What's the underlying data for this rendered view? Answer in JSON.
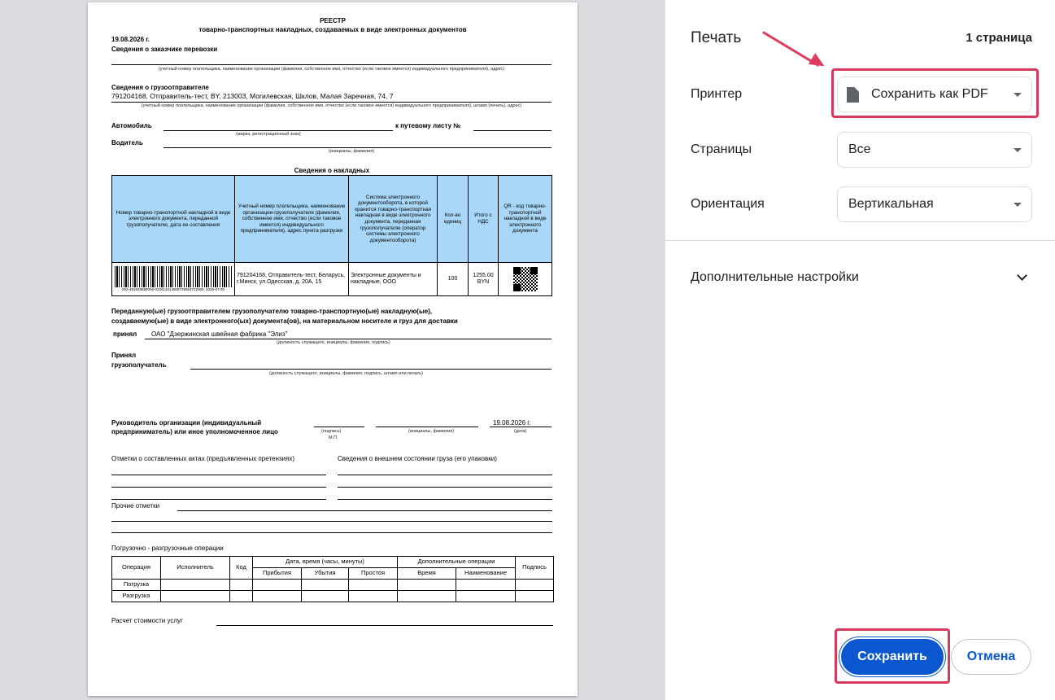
{
  "document": {
    "title": "РЕЕСТР",
    "subtitle": "товарно-транспортных накладных, создаваемых в виде электронных документов",
    "date": "19.08.2026 г.",
    "customer_heading": "Сведения о заказчике перевозки",
    "customer_note": "(учетный номер плательщика, наименование организации (фамилия, собственное имя, отчество (если таковое имеется) индивидуального предпринимателя), адрес)",
    "shipper_heading": "Сведения о грузоотправителе",
    "shipper_value": "791204168, Отправитель-тест, BY, 213003, Могилевская, Шклов, Малая Заречная, 74, 7",
    "shipper_note": "(учетный номер плательщика, наименование организации (фамилия, собственное имя, отчество (если таковое имеется) индивидуального предпринимателя), штамп (печать), адрес)",
    "car_label": "Автомобиль",
    "waybill_label": "к путевому листу №",
    "car_note": "(марка, регистрационный знак)",
    "driver_label": "Водитель",
    "driver_note": "(инициалы, фамилия)",
    "invoices_heading": "Сведения о накладных",
    "invoice_columns": [
      "Номер товарно-транспортной накладной в виде электронного документа, переданной грузополучателю, дата ее составления",
      "Учетный номер плательщика, наименование организации-грузополучателя (фамилия, собственное имя, отчество (если таковое имеется) индивидуального предпринимателя), адрес пункта разгрузки",
      "Система электронного документооборота, в которой хранится товарно-транспортная накладная в виде электронного документа, переданная грузополучателю (оператор системы электронного документооборота)",
      "Кол-во единиц",
      "Итого с НДС",
      "QR - код товарно-транспортной накладной в виде электронного документа"
    ],
    "invoice_row": {
      "barcode_text": "002-481929589006-022813414909739953722060, 2026-07-30",
      "consignee": "791204168, Отправитель-тест, Беларусь, г.Минск, ул.Одесская, д. 20А, 15",
      "system": "Электронные документы и накладные, ООО",
      "qty": "100",
      "total": "1255.00 BYN"
    },
    "transfer_text_1": "Переданную(ые) грузоотправителем грузополучателю товарно-транспортную(ые) накладную(ые),",
    "transfer_text_2": "создаваемую(ые) в виде электронного(ых) документа(ов), на материальном носителе и груз для доставки",
    "accepted_label": "принял",
    "accepted_value": "ОАО \"Дзержинская швейная фабрика \"Элиз\"",
    "accepted_note": "(должность служащего, инициалы, фамилия, подпись)",
    "consignee_label_1": "Принял",
    "consignee_label_2": "грузополучатель",
    "consignee_note": "(должность служащего, инициалы, фамилия, подпись, штамп или печать)",
    "head_label_1": "Руководитель организации (индивидуальный",
    "head_label_2": "предприниматель) или иное уполномоченное лицо",
    "sign_note": "(подпись)",
    "mp_note": "М.П.",
    "initials_note": "(инициалы, фамилия)",
    "head_date": "19.08.2026 г.",
    "date_note": "(дата)",
    "acts_label": "Отметки о составленных актах (предъявленных претензиях)",
    "condition_label": "Сведения о внешнем состоянии груза (его упаковки)",
    "other_label": "Прочие отметки",
    "loading_label": "Погрузочно - разгрузочные операции",
    "ops_headers": {
      "operation": "Операция",
      "executor": "Исполнитель",
      "code": "Код",
      "datetime": "Дата, время (часы, минуты)",
      "arrival": "Прибытия",
      "departure": "Убытия",
      "idle": "Простоя",
      "extra": "Дополнительные операции",
      "time": "Время",
      "name": "Наименование",
      "signature": "Подпись"
    },
    "ops_rows": [
      "Погрузка",
      "Разгрузка"
    ],
    "cost_label": "Расчет стоимости услуг"
  },
  "panel": {
    "title": "Печать",
    "page_count": "1 страница",
    "printer_label": "Принтер",
    "printer_value": "Сохранить как PDF",
    "pages_label": "Страницы",
    "pages_value": "Все",
    "orientation_label": "Ориентация",
    "orientation_value": "Вертикальная",
    "more_settings": "Дополнительные настройки",
    "save_button": "Сохранить",
    "cancel_button": "Отмена"
  },
  "colors": {
    "accent": "#0b57d0",
    "highlight": "#d63a5a",
    "table_header": "#a8d7f7"
  },
  "icons": [
    "document-icon",
    "chevron-down-icon",
    "dropdown-caret-icon",
    "annotation-arrow"
  ]
}
